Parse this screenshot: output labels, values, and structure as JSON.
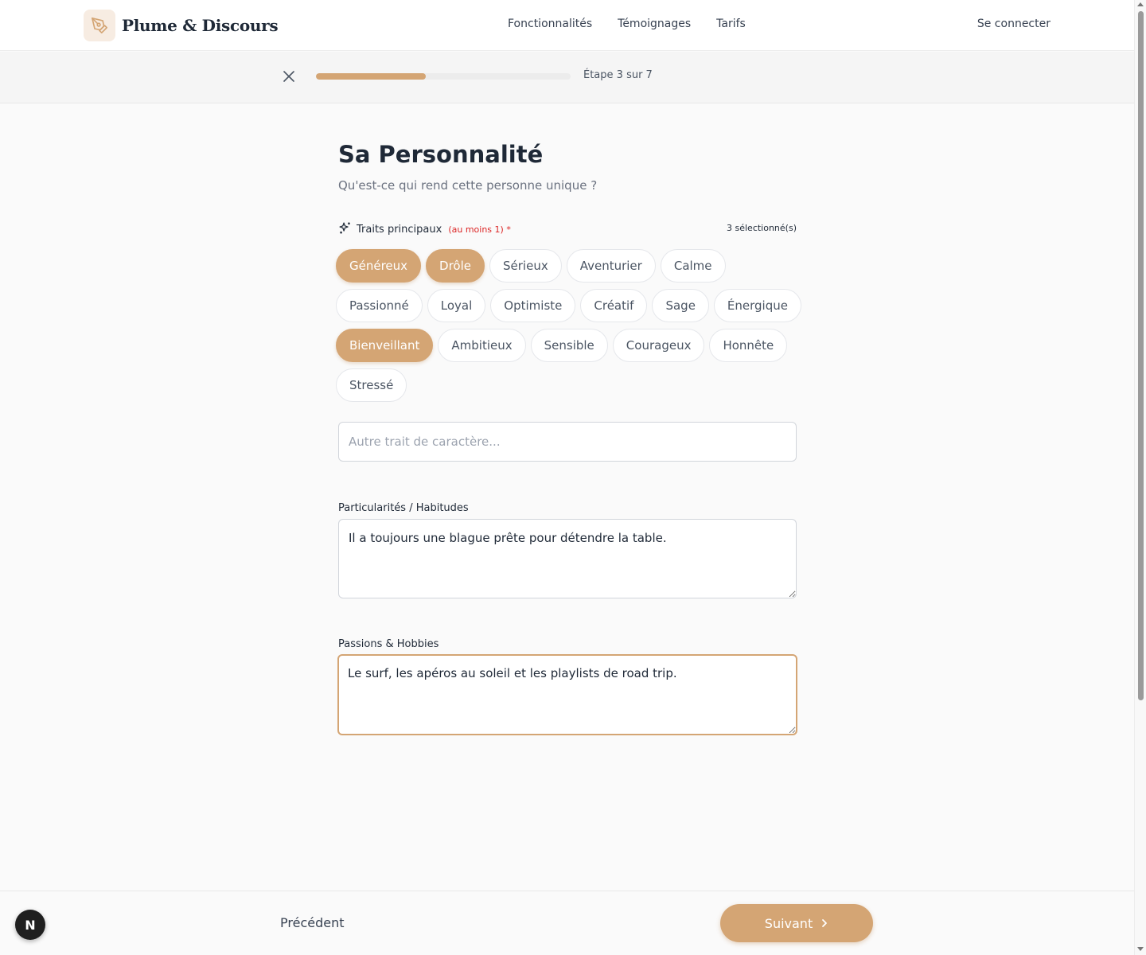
{
  "brand": {
    "name": "Plume & Discours",
    "logo_icon": "pen-nib-icon"
  },
  "nav": {
    "items": [
      "Fonctionnalités",
      "Témoignages",
      "Tarifs"
    ],
    "login": "Se connecter"
  },
  "progress": {
    "step_label": "Étape 3 sur 7",
    "current": 3,
    "total": 7,
    "fraction": 0.43
  },
  "page": {
    "title": "Sa Personnalité",
    "subtitle": "Qu'est-ce qui rend cette personne unique ?"
  },
  "traits": {
    "label": "Traits principaux",
    "hint": "(au moins 1) *",
    "count": "3 sélectionné(s)",
    "icon": "sparkles-icon",
    "options": [
      {
        "label": "Généreux",
        "selected": true
      },
      {
        "label": "Drôle",
        "selected": true
      },
      {
        "label": "Sérieux",
        "selected": false
      },
      {
        "label": "Aventurier",
        "selected": false
      },
      {
        "label": "Calme",
        "selected": false
      },
      {
        "label": "Passionné",
        "selected": false
      },
      {
        "label": "Loyal",
        "selected": false
      },
      {
        "label": "Optimiste",
        "selected": false
      },
      {
        "label": "Créatif",
        "selected": false
      },
      {
        "label": "Sage",
        "selected": false
      },
      {
        "label": "Énergique",
        "selected": false
      },
      {
        "label": "Bienveillant",
        "selected": true
      },
      {
        "label": "Ambitieux",
        "selected": false
      },
      {
        "label": "Sensible",
        "selected": false
      },
      {
        "label": "Courageux",
        "selected": false
      },
      {
        "label": "Honnête",
        "selected": false
      },
      {
        "label": "Stressé",
        "selected": false
      }
    ],
    "other_placeholder": "Autre trait de caractère..."
  },
  "habits": {
    "label": "Particularités / Habitudes",
    "value": "Il a toujours une blague prête pour détendre la table."
  },
  "passions": {
    "label": "Passions & Hobbies",
    "value": "Le surf, les apéros au soleil et les playlists de road trip."
  },
  "footer": {
    "prev": "Précédent",
    "next": "Suivant"
  },
  "dev_badge": {
    "letter": "N"
  },
  "colors": {
    "accent": "#d4a574",
    "required": "#dc2626",
    "text": "#1f2937"
  }
}
